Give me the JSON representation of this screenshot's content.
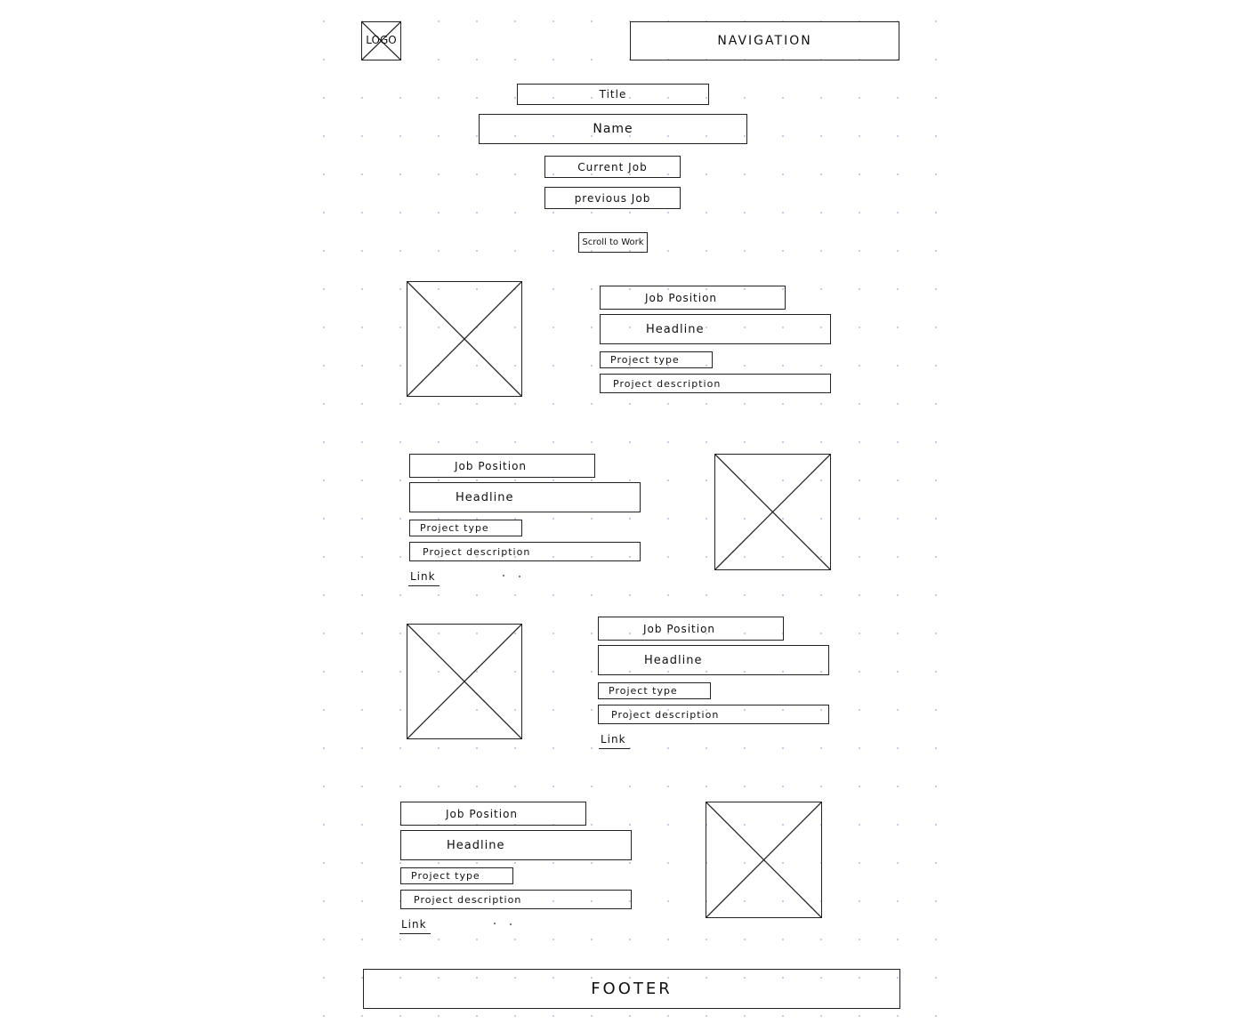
{
  "header": {
    "logo_label": "LOGO",
    "navigation_label": "NAVIGATION"
  },
  "hero": {
    "title": "Title",
    "name": "Name",
    "current_job": "Current Job",
    "previous_job": "previous Job",
    "scroll_button": "Scroll to Work"
  },
  "projects": [
    {
      "job_position": "Job Position",
      "headline": "Headline",
      "project_type": "Project type",
      "project_description": "Project description",
      "image_placeholder": "image-placeholder",
      "image_side": "left"
    },
    {
      "job_position": "Job Position",
      "headline": "Headline",
      "project_type": "Project type",
      "project_description": "Project description",
      "link": "Link",
      "image_placeholder": "image-placeholder",
      "image_side": "right"
    },
    {
      "job_position": "Job Position",
      "headline": "Headline",
      "project_type": "Project type",
      "project_description": "Project description",
      "link": "Link",
      "image_placeholder": "image-placeholder",
      "image_side": "left"
    },
    {
      "job_position": "Job Position",
      "headline": "Headline",
      "project_type": "Project type",
      "project_description": "Project description",
      "link": "Link",
      "image_placeholder": "image-placeholder",
      "image_side": "right"
    }
  ],
  "footer": {
    "label": "FOOTER"
  },
  "colors": {
    "stroke": "#222222",
    "grid_dot": "#b7c5e0",
    "background": "#ffffff"
  }
}
